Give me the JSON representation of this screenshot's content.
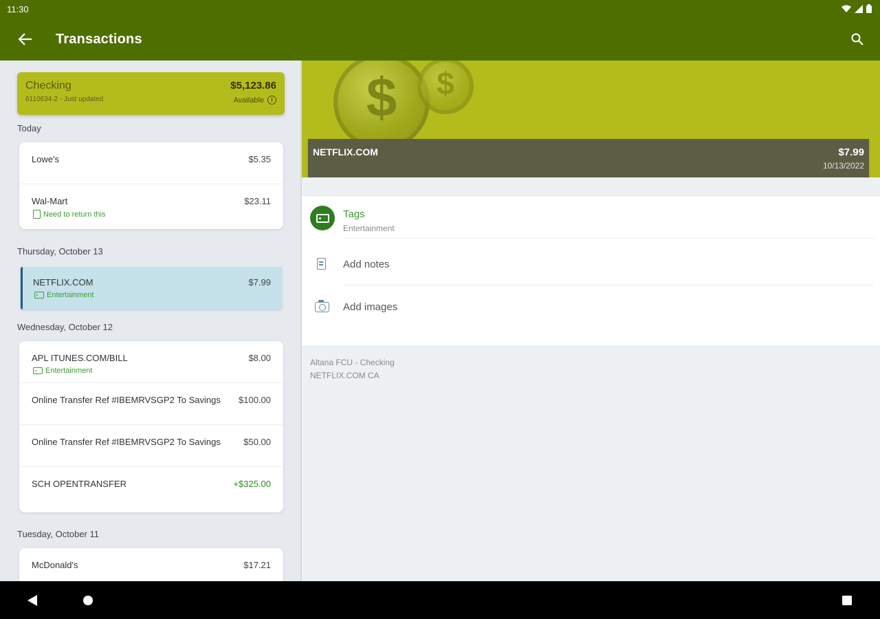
{
  "status": {
    "time": "11:30"
  },
  "appbar": {
    "title": "Transactions"
  },
  "account": {
    "name": "Checking",
    "subtitle": "6110634-2 - Just updated",
    "balance": "$5,123.86",
    "balance_label": "Available"
  },
  "groups": [
    {
      "label": "Today",
      "items": [
        {
          "desc": "Lowe's",
          "amount": "$5.35",
          "tag": ""
        },
        {
          "desc": "Wal-Mart",
          "amount": "$23.11",
          "note": "Need to return this"
        }
      ]
    },
    {
      "label": "Thursday, October 13",
      "items": [
        {
          "desc": "NETFLIX.COM",
          "amount": "$7.99",
          "tag": "Entertainment"
        }
      ]
    },
    {
      "label": "Wednesday, October 12",
      "items": [
        {
          "desc": "APL ITUNES.COM/BILL",
          "amount": "$8.00",
          "tag": "Entertainment"
        },
        {
          "desc": "Online Transfer Ref #IBEMRVSGP2 To Savings",
          "amount": "$100.00"
        },
        {
          "desc": "Online Transfer Ref #IBEMRVSGP2 To Savings",
          "amount": "$50.00"
        },
        {
          "desc": "SCH OPENTRANSFER",
          "amount": "+$325.00"
        }
      ]
    },
    {
      "label": "Tuesday, October 11",
      "items": [
        {
          "desc": "McDonald's",
          "amount": "$17.21"
        }
      ]
    }
  ],
  "detail": {
    "merchant": "NETFLIX.COM",
    "amount": "$7.99",
    "date": "10/13/2022",
    "tags_label": "Tags",
    "tags_value": "Entertainment",
    "add_notes": "Add notes",
    "add_images": "Add images",
    "account_line": "Altana FCU - Checking",
    "raw_desc": "NETFLIX.COM CA",
    "coin_symbol": "$"
  },
  "colors": {
    "appbar": "#4f6e00",
    "account_card": "#b4bc1c",
    "selected_row": "#c5e1ea",
    "positive": "#2e8b20",
    "tag_green": "#3f9a35"
  },
  "icons": [
    "back-arrow-icon",
    "search-icon",
    "info-icon",
    "tag-icon",
    "note-icon",
    "notes-icon",
    "camera-icon",
    "wifi-icon",
    "signal-icon",
    "battery-icon",
    "nav-back-icon",
    "nav-home-icon",
    "nav-recents-icon"
  ]
}
